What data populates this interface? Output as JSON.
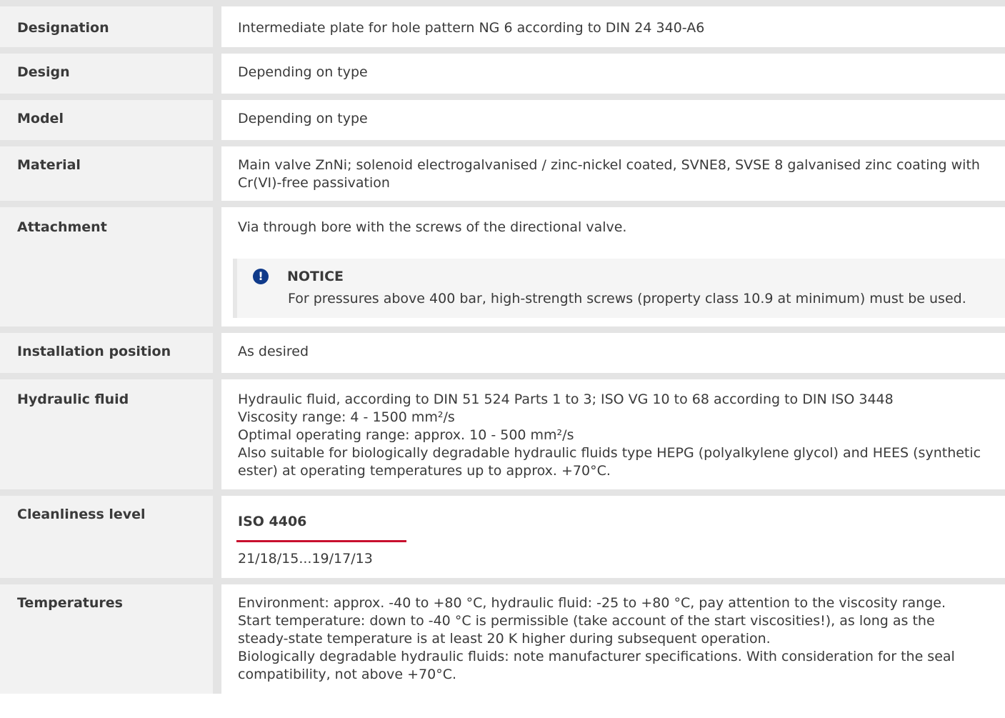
{
  "rows": {
    "designation": {
      "label": "Designation",
      "value": "Intermediate plate for hole pattern NG 6 according to DIN 24 340-A6"
    },
    "design": {
      "label": "Design",
      "value": "Depending on type"
    },
    "model": {
      "label": "Model",
      "value": "Depending on type"
    },
    "material": {
      "label": "Material",
      "lines": [
        "Main valve ZnNi; solenoid electrogalvanised / zinc-nickel coated, SVNE8, SVSE 8 galvanised zinc coating with",
        "Cr(VI)-free passivation"
      ]
    },
    "attachment": {
      "label": "Attachment",
      "value": "Via through bore with the screws of the directional valve.",
      "notice": {
        "icon": "exclamation-icon",
        "title": "NOTICE",
        "text": "For pressures above 400 bar, high-strength screws (property class 10.9 at minimum) must be used."
      }
    },
    "installation": {
      "label": "Installation position",
      "value": "As desired"
    },
    "hydraulic": {
      "label": "Hydraulic fluid",
      "lines": [
        "Hydraulic fluid, according to DIN 51 524 Parts 1 to 3; ISO VG 10 to 68 according to DIN ISO 3448",
        "Viscosity range: 4 - 1500 mm²/s",
        "Optimal operating range: approx. 10 - 500 mm²/s",
        "Also suitable for biologically degradable hydraulic fluids type HEPG (polyalkylene glycol) and HEES (synthetic",
        "ester) at operating temperatures up to approx. +70°C."
      ]
    },
    "cleanliness": {
      "label": "Cleanliness level",
      "subheading": "ISO 4406",
      "value": "21/18/15...19/17/13"
    },
    "temperatures": {
      "label": "Temperatures",
      "lines": [
        "Environment: approx. -40 to +80 °C, hydraulic fluid: -25 to +80 °C, pay attention to the viscosity range.",
        "Start temperature: down to -40 °C is permissible (take account of the start viscosities!), as long as the",
        "steady-state temperature is at least 20 K higher during subsequent operation.",
        "Biologically degradable hydraulic fluids: note manufacturer specifications. With consideration for the seal",
        "compatibility, not above +70°C."
      ]
    }
  },
  "colors": {
    "accent_red": "#c8102e",
    "notice_icon_blue": "#0f3a8a",
    "label_bg": "#f2f2f2",
    "separator": "#e4e4e4"
  }
}
